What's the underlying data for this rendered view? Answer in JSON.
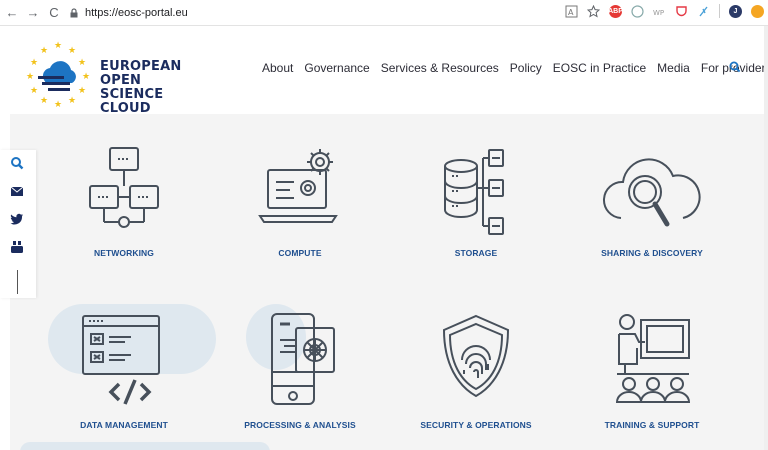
{
  "browser": {
    "url": "https://eosc-portal.eu",
    "back_icon": "←",
    "forward_icon": "→",
    "reload_icon": "C",
    "ext_badge": "ABP",
    "profile_initial": "J"
  },
  "header": {
    "logo_line1": "EUROPEAN OPEN",
    "logo_line2": "SCIENCE CLOUD",
    "nav": [
      "About",
      "Governance",
      "Services & Resources",
      "Policy",
      "EOSC in Practice",
      "Media",
      "For providers"
    ]
  },
  "tiles": [
    {
      "label": "NETWORKING"
    },
    {
      "label": "COMPUTE"
    },
    {
      "label": "STORAGE"
    },
    {
      "label": "SHARING & DISCOVERY"
    },
    {
      "label": "DATA MANAGEMENT"
    },
    {
      "label": "PROCESSING & ANALYSIS"
    },
    {
      "label": "SECURITY & OPERATIONS"
    },
    {
      "label": "TRAINING & SUPPORT"
    }
  ],
  "colors": {
    "icon_stroke": "#47505b",
    "label": "#1f4f8f",
    "brand_navy": "#1b2c5e",
    "accent_blue": "#1d74c3",
    "star_yellow": "#f2c21b"
  }
}
